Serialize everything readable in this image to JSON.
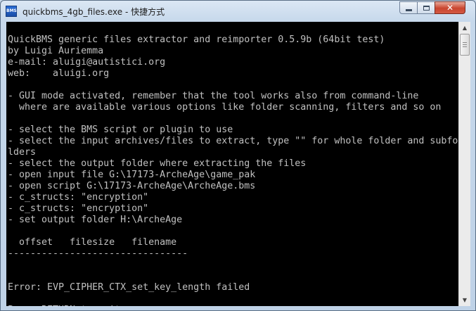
{
  "window": {
    "title": "quickbms_4gb_files.exe - 快捷方式",
    "icon_label": "BMS",
    "icon": "quickbms-app-icon",
    "controls": {
      "minimize": "minimize-icon",
      "maximize": "maximize-icon",
      "close_glyph": "✕"
    }
  },
  "console": {
    "background": "#000000",
    "text_color": "#c0c0c0",
    "lines": [
      "",
      "QuickBMS generic files extractor and reimporter 0.5.9b (64bit test)",
      "by Luigi Auriemma",
      "e-mail: aluigi@autistici.org",
      "web:    aluigi.org",
      "",
      "- GUI mode activated, remember that the tool works also from command-line",
      "  where are available various options like folder scanning, filters and so on",
      "",
      "- select the BMS script or plugin to use",
      "- select the input archives/files to extract, type \"\" for whole folder and subfo",
      "lders",
      "- select the output folder where extracting the files",
      "- open input file G:\\17173-ArcheAge\\game_pak",
      "- open script G:\\17173-ArcheAge\\ArcheAge.bms",
      "- c_structs: \"encryption\"",
      "- c_structs: \"encryption\"",
      "- set output folder H:\\ArcheAge",
      "",
      "  offset   filesize   filename",
      "--------------------------------",
      "",
      "",
      "Error: EVP_CIPHER_CTX_set_key_length failed",
      "",
      "Press RETURN to quit"
    ]
  },
  "scrollbar": {
    "up_arrow": "▲",
    "down_arrow": "▼",
    "position_fraction": 0.0
  }
}
